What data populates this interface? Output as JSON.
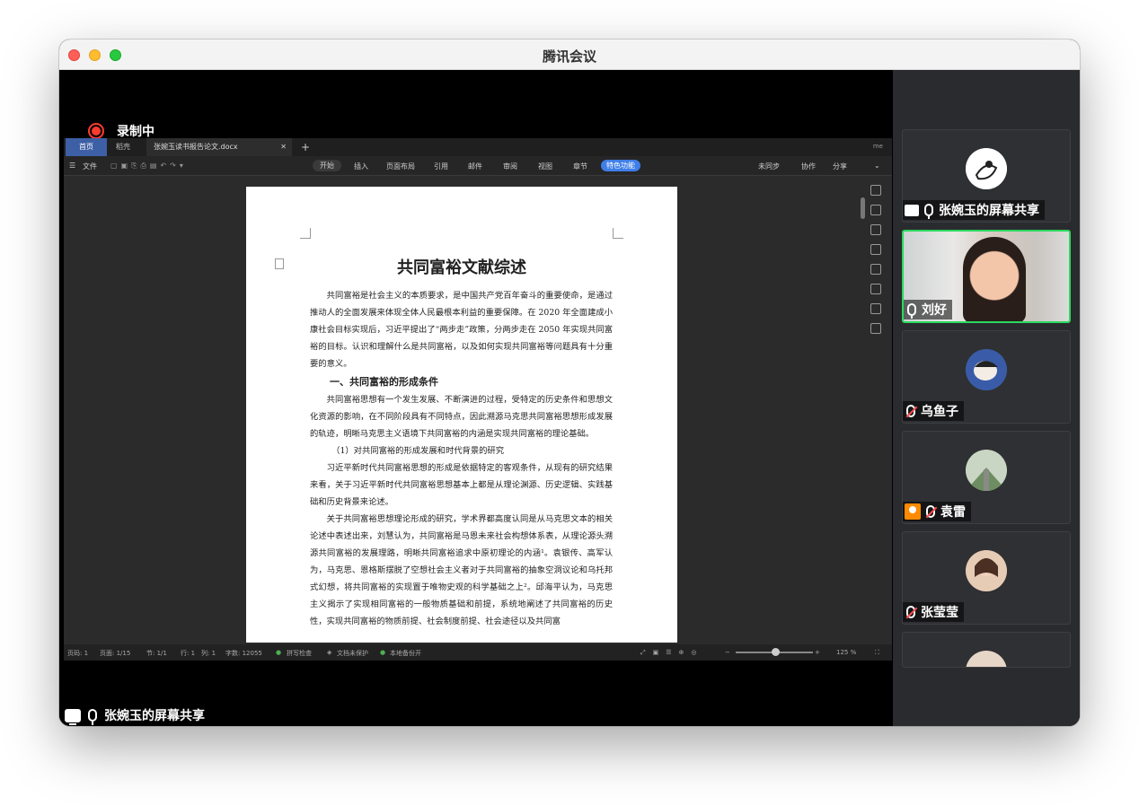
{
  "window": {
    "title": "腾讯会议"
  },
  "recording": {
    "label": "录制中"
  },
  "screen_share": {
    "label": "张婉玉的屏幕共享"
  },
  "wps": {
    "tabs": [
      {
        "label": "首页"
      },
      {
        "label": "稻壳"
      },
      {
        "label": "张婉玉读书报告论文.docx"
      }
    ],
    "top_right": "me",
    "ribbon": {
      "menu": "文件",
      "items": [
        "开始",
        "插入",
        "页面布局",
        "引用",
        "邮件",
        "审阅",
        "视图",
        "章节"
      ],
      "feature": "特色功能",
      "right": [
        "未同步",
        "协作",
        "分享"
      ]
    },
    "document": {
      "title": "共同富裕文献综述",
      "p1": "共同富裕是社会主义的本质要求，是中国共产党百年奋斗的重要使命，是通过推动人的全面发展来体现全体人民最根本利益的重要保障。在 2020 年全面建成小康社会目标实现后，习近平提出了“两步走”政策，分两步走在 2050 年实现共同富裕的目标。认识和理解什么是共同富裕，以及如何实现共同富裕等问题具有十分重要的意义。",
      "h1": "一、共同富裕的形成条件",
      "p2": "共同富裕思想有一个发生发展、不断演进的过程，受特定的历史条件和思想文化资源的影响，在不同阶段具有不同特点，因此溯源马克思共同富裕思想形成发展的轨迹，明晰马克思主义语境下共同富裕的内涵是实现共同富裕的理论基础。",
      "sub1": "（1）对共同富裕的形成发展和时代背景的研究",
      "p3": "习近平新时代共同富裕思想的形成是依据特定的客观条件，从现有的研究结果来看，关于习近平新时代共同富裕思想基本上都是从理论渊源、历史逻辑、实践基础和历史背景来论述。",
      "p4": "关于共同富裕思想理论形成的研究，学术界都高度认同是从马克思文本的相关论述中表述出来，刘慧认为，共同富裕是马恩未来社会构想体系表，从理论源头溯源共同富裕的发展理路，明晰共同富裕追求中原初理论的内涵¹。袁银传、高军认为，马克思、恩格斯摆脱了空想社会主义者对于共同富裕的抽象空洞议论和乌托邦式幻想，将共同富裕的实现置于唯物史观的科学基础之上²。邱海平认为，马克思主义揭示了实现相同富裕的一般物质基础和前提，系统地阐述了共同富裕的历史性，实现共同富裕的物质前提、社会制度前提、社会途径以及共同富"
    },
    "status": {
      "page_code": "页码: 1",
      "pages": "页面: 1/15",
      "section": "节: 1/1",
      "row": "行: 1",
      "col": "列: 1",
      "words": "字数: 12055",
      "spell": "拼写检查",
      "protect": "文档未保护",
      "backup": "本地备份开",
      "zoom": "125 %"
    }
  },
  "participants": [
    {
      "name": "张婉玉的屏幕共享",
      "mic": "on",
      "kind": "share"
    },
    {
      "name": "刘好",
      "mic": "on",
      "kind": "video"
    },
    {
      "name": "乌鱼子",
      "mic": "off",
      "kind": "avatar"
    },
    {
      "name": "袁雷",
      "mic": "off",
      "kind": "avatar",
      "host": true
    },
    {
      "name": "张莹莹",
      "mic": "off",
      "kind": "avatar"
    }
  ],
  "colors": {
    "active_speaker": "#2bd95f",
    "recording": "#ff3b30",
    "wps_accent": "#3f7ee8"
  }
}
